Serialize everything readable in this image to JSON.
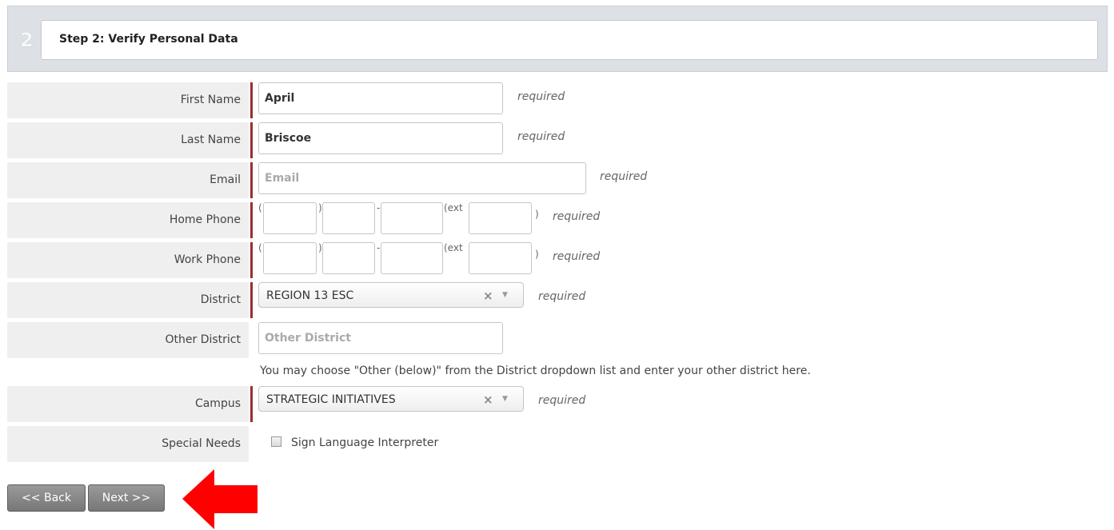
{
  "step": {
    "number": "2",
    "title": "Step 2: Verify Personal Data"
  },
  "fields": {
    "first_name": {
      "label": "First Name",
      "value": "April",
      "required": "required"
    },
    "last_name": {
      "label": "Last Name",
      "value": "Briscoe",
      "required": "required"
    },
    "email": {
      "label": "Email",
      "value": "",
      "placeholder": "Email",
      "required": "required"
    },
    "home_phone": {
      "label": "Home Phone",
      "open_paren": "(",
      "close_paren": ")",
      "dash": "-",
      "ext": "(ext",
      "ext_close": ")",
      "required": "required"
    },
    "work_phone": {
      "label": "Work Phone",
      "open_paren": "(",
      "close_paren": ")",
      "dash": "-",
      "ext": "(ext",
      "ext_close": ")",
      "required": "required"
    },
    "district": {
      "label": "District",
      "value": "REGION 13 ESC",
      "clear": "×",
      "arrow": "▼",
      "required": "required"
    },
    "other_district": {
      "label": "Other District",
      "value": "",
      "placeholder": "Other District",
      "helper": "You may choose \"Other (below)\" from the District dropdown list and enter your other district here."
    },
    "campus": {
      "label": "Campus",
      "value": "STRATEGIC INITIATIVES",
      "clear": "×",
      "arrow": "▼",
      "required": "required"
    },
    "special_needs": {
      "label": "Special Needs",
      "option": "Sign Language Interpreter",
      "checked": false
    }
  },
  "buttons": {
    "back": "<< Back",
    "next": "Next >>"
  },
  "annotation": {
    "arrow_color": "#ff0000"
  },
  "colors": {
    "required_bar": "#9b2c2c",
    "label_bg": "#efefef",
    "button_bg": "#888888"
  }
}
